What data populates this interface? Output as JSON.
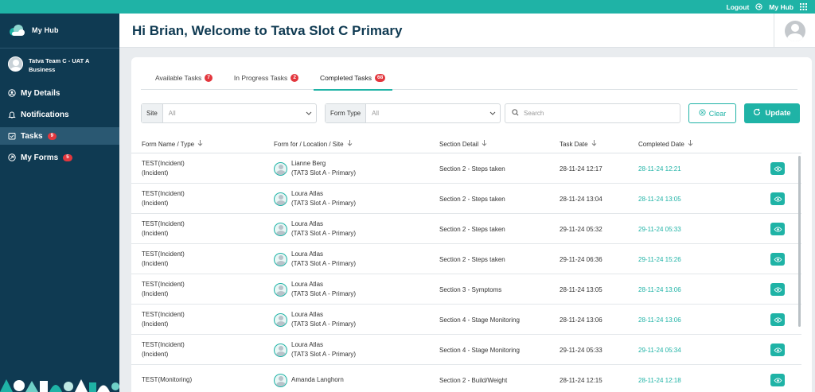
{
  "topbar": {
    "logout": "Logout",
    "my_hub": "My Hub"
  },
  "sidebar": {
    "brand": "My Hub",
    "user_name": "Tatva Team C - UAT A Business",
    "items": [
      {
        "label": "My Details",
        "icon": "user-circle-icon"
      },
      {
        "label": "Notifications",
        "icon": "bell-icon"
      },
      {
        "label": "Tasks",
        "icon": "checkbox-icon",
        "badge": "9",
        "active": true
      },
      {
        "label": "My Forms",
        "icon": "clipboard-icon",
        "badge": "5"
      }
    ]
  },
  "header": {
    "title": "Hi Brian, Welcome to Tatva Slot C Primary"
  },
  "tabs": [
    {
      "label": "Available Tasks",
      "count": "7"
    },
    {
      "label": "In Progress Tasks",
      "count": "2"
    },
    {
      "label": "Completed Tasks",
      "count": "68",
      "active": true
    }
  ],
  "filters": {
    "site_label": "Site",
    "site_value": "All",
    "form_type_label": "Form Type",
    "form_type_value": "All",
    "search_placeholder": "Search",
    "clear_label": "Clear",
    "update_label": "Update"
  },
  "table": {
    "columns": [
      "Form Name / Type",
      "Form for / Location / Site",
      "Section Detail",
      "Task Date",
      "Completed Date"
    ],
    "rows": [
      {
        "name1": "TEST(Incident)",
        "name2": "(Incident)",
        "person": "Lianne Berg",
        "site": "(TAT3 Slot A - Primary)",
        "section": "Section 2 - Steps taken",
        "task_date": "28-11-24 12:17",
        "completed": "28-11-24 12:21"
      },
      {
        "name1": "TEST(Incident)",
        "name2": "(Incident)",
        "person": "Loura Atlas",
        "site": "(TAT3 Slot A - Primary)",
        "section": "Section 2 - Steps taken",
        "task_date": "28-11-24 13:04",
        "completed": "28-11-24 13:05"
      },
      {
        "name1": "TEST(Incident)",
        "name2": "(Incident)",
        "person": "Loura Atlas",
        "site": "(TAT3 Slot A - Primary)",
        "section": "Section 2 - Steps taken",
        "task_date": "29-11-24 05:32",
        "completed": "29-11-24 05:33"
      },
      {
        "name1": "TEST(Incident)",
        "name2": "(Incident)",
        "person": "Loura Atlas",
        "site": "(TAT3 Slot A - Primary)",
        "section": "Section 2 - Steps taken",
        "task_date": "29-11-24 06:36",
        "completed": "29-11-24 15:26"
      },
      {
        "name1": "TEST(Incident)",
        "name2": "(Incident)",
        "person": "Loura Atlas",
        "site": "(TAT3 Slot A - Primary)",
        "section": "Section 3 - Symptoms",
        "task_date": "28-11-24 13:05",
        "completed": "28-11-24 13:06"
      },
      {
        "name1": "TEST(Incident)",
        "name2": "(Incident)",
        "person": "Loura Atlas",
        "site": "(TAT3 Slot A - Primary)",
        "section": "Section 4 - Stage Monitoring",
        "task_date": "28-11-24 13:06",
        "completed": "28-11-24 13:06"
      },
      {
        "name1": "TEST(Incident)",
        "name2": "(Incident)",
        "person": "Loura Atlas",
        "site": "(TAT3 Slot A - Primary)",
        "section": "Section 4 - Stage Monitoring",
        "task_date": "29-11-24 05:33",
        "completed": "29-11-24 05:34"
      },
      {
        "name1": "TEST(Monitoring)",
        "name2": "",
        "person": "Amanda Langhorn",
        "site": "",
        "section": "Section 2 - Build/Weight",
        "task_date": "28-11-24 12:15",
        "completed": "28-11-24 12:18"
      }
    ]
  },
  "colors": {
    "accent": "#1fb3a6",
    "sidebar": "#0f3a52",
    "badge": "#e3373e"
  }
}
